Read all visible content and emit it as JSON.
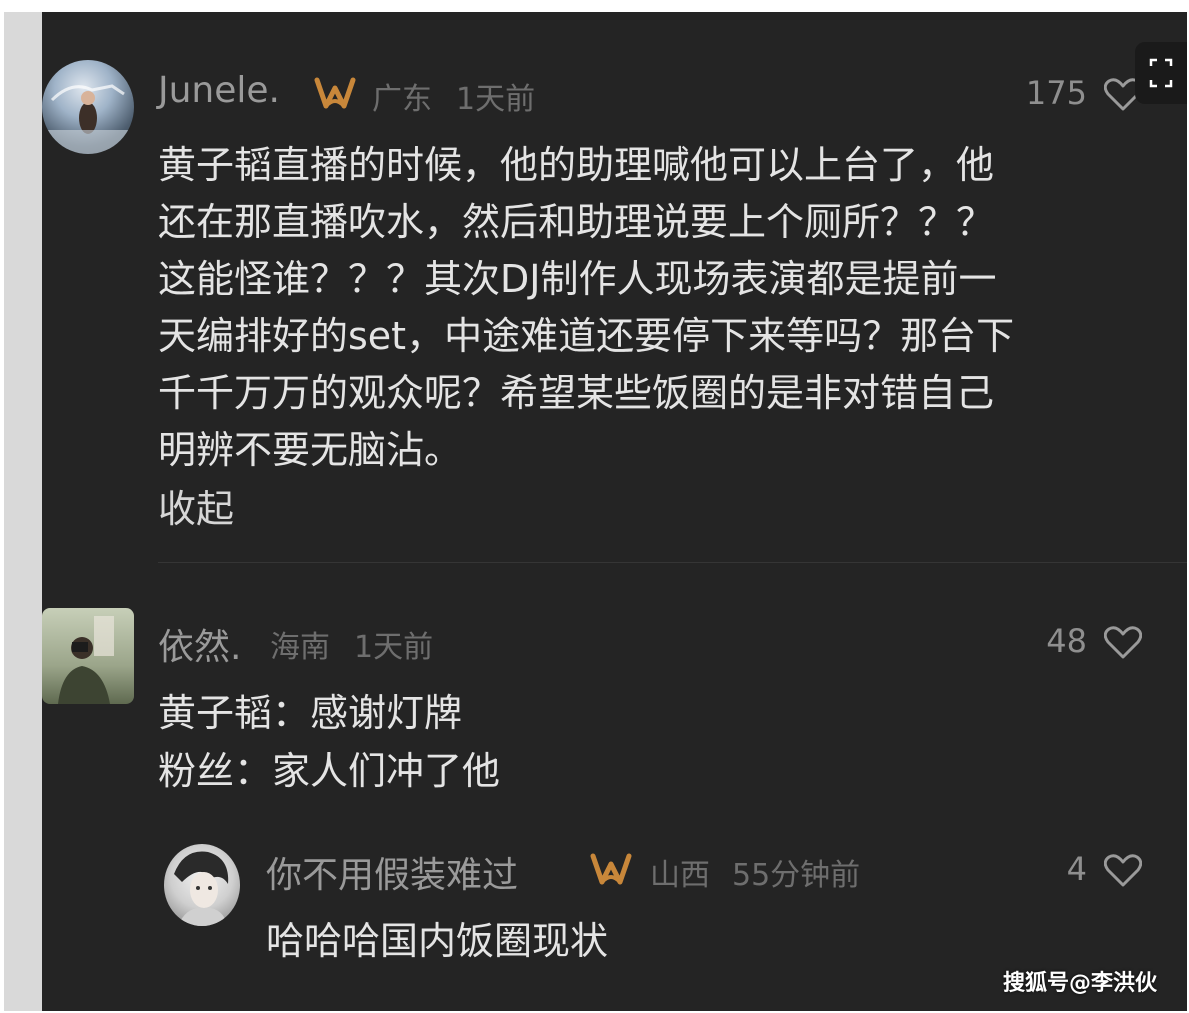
{
  "comments": [
    {
      "user": "Junele.",
      "has_badge": true,
      "location": "广东",
      "time": "1天前",
      "likes": "175",
      "lines": [
        "黄子韬直播的时候，他的助理喊他可以上台了，他",
        "还在那直播吹水，然后和助理说要上个厕所？？？",
        "这能怪谁？？？其次DJ制作人现场表演都是提前一",
        "天编排好的set，中途难道还要停下来等吗？那台下",
        "千千万万的观众呢？希望某些饭圈的是非对错自己",
        "明辨不要无脑沾。"
      ],
      "collapse_label": "收起"
    },
    {
      "user": "依然.",
      "location": "海南",
      "time": "1天前",
      "likes": "48",
      "lines": [
        "黄子韬：感谢灯牌",
        "粉丝：家人们冲了他"
      ]
    },
    {
      "user": "你不用假装难过",
      "has_badge": true,
      "location": "山西",
      "time": "55分钟前",
      "likes": "4",
      "lines": [
        "哈哈哈国内饭圈现状"
      ]
    }
  ],
  "watermark": "搜狐号@李洪伙",
  "icons": {
    "badge": "vip-badge-icon",
    "like": "heart-icon",
    "fullscreen": "fullscreen-icon"
  },
  "colors": {
    "background": "#242424",
    "badge": "#c8873a",
    "text": "#e4e4e4",
    "meta": "#6e6e6e"
  }
}
